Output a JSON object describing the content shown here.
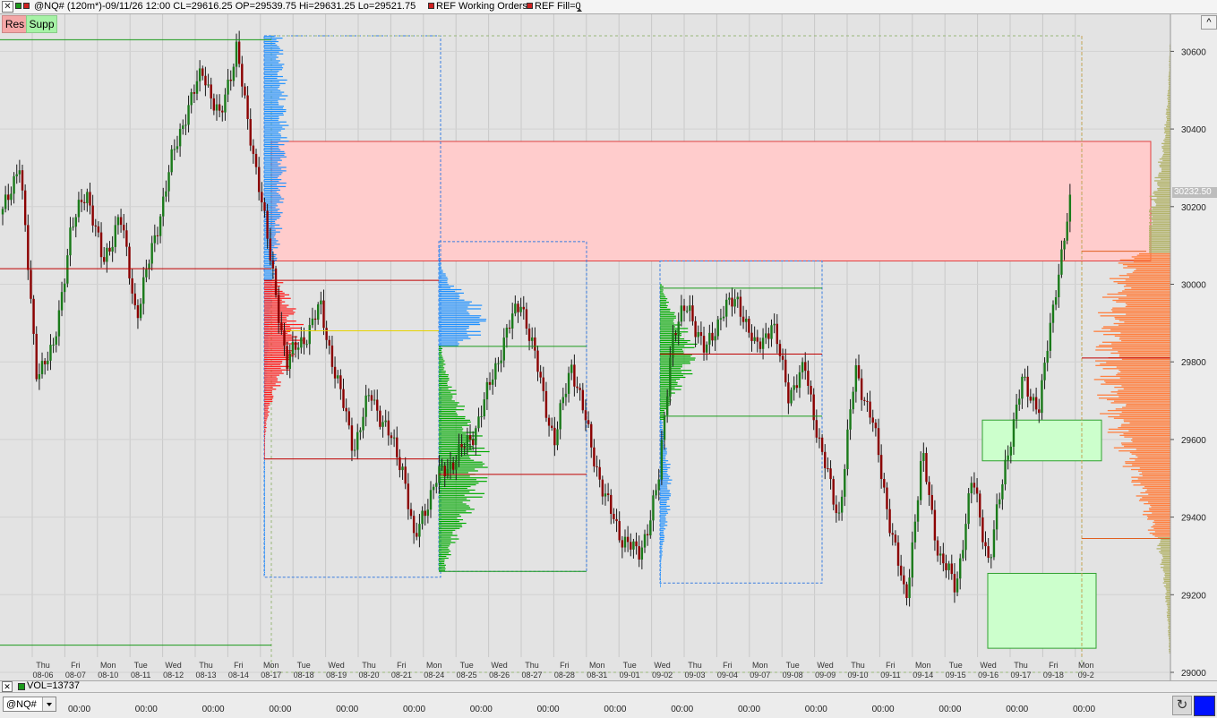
{
  "window": {
    "close_glyph": "✕",
    "title_text": "@NQ# (120m*)-09/11/26 12:00 CL=29616.25 OP=29539.75 Hi=29631.25 Lo=29521.75",
    "legend_working_orders": "REF Working Orders",
    "legend_fill": "REF Fill=0",
    "legend_color": "#e02020"
  },
  "toolbar": {
    "res_label": "Res",
    "supp_label": "Supp",
    "collapse_glyph": "^"
  },
  "colors": {
    "resistance_zone": "#ffcccc",
    "support_zone": "#ccffcc",
    "candle_down": "#8b0000",
    "candle_up": "#1a7a1a",
    "profile_blue": "#1e90ff",
    "profile_red": "#ff1a1a",
    "profile_green": "#00aa00",
    "profile_orange": "#ff8040",
    "profile_olive": "#b3b36b"
  },
  "chart_data": {
    "type": "candlestick",
    "instrument": "@NQ#",
    "interval": "120m",
    "y_axis_range": [
      28990,
      30640
    ],
    "y_ticks": [
      30600,
      30400,
      30200,
      30000,
      29800,
      29600,
      29400,
      29200,
      29000
    ],
    "y_tick_labels": [
      "30600",
      "30400",
      "30200",
      "30000",
      "29800",
      "29600",
      "29400",
      "29200",
      "29000"
    ],
    "last_price_label": "30232.50",
    "x_days": [
      {
        "dow": "Thu",
        "date": "08-06"
      },
      {
        "dow": "Fri",
        "date": "08-07"
      },
      {
        "dow": "Mon",
        "date": "08-10"
      },
      {
        "dow": "Tue",
        "date": "08-11"
      },
      {
        "dow": "Wed",
        "date": "08-12"
      },
      {
        "dow": "Thu",
        "date": "08-13"
      },
      {
        "dow": "Fri",
        "date": "08-14"
      },
      {
        "dow": "Mon",
        "date": "08-17"
      },
      {
        "dow": "Tue",
        "date": "08-18"
      },
      {
        "dow": "Wed",
        "date": "08-19"
      },
      {
        "dow": "Thu",
        "date": "08-20"
      },
      {
        "dow": "Fri",
        "date": "08-21"
      },
      {
        "dow": "Mon",
        "date": "08-24"
      },
      {
        "dow": "Tue",
        "date": "08-25"
      },
      {
        "dow": "Wed",
        "date": "08-26"
      },
      {
        "dow": "Thu",
        "date": "08-27"
      },
      {
        "dow": "Fri",
        "date": "08-28"
      },
      {
        "dow": "Mon",
        "date": "08-31"
      },
      {
        "dow": "Tue",
        "date": "09-01"
      },
      {
        "dow": "Wed",
        "date": "09-02"
      },
      {
        "dow": "Thu",
        "date": "09-03"
      },
      {
        "dow": "Fri",
        "date": "09-04"
      },
      {
        "dow": "Mon",
        "date": "09-07"
      },
      {
        "dow": "Tue",
        "date": "09-08"
      },
      {
        "dow": "Wed",
        "date": "09-09"
      },
      {
        "dow": "Thu",
        "date": "09-10"
      },
      {
        "dow": "Fri",
        "date": "09-11"
      },
      {
        "dow": "Mon",
        "date": "09-14"
      },
      {
        "dow": "Tue",
        "date": "09-15"
      },
      {
        "dow": "Wed",
        "date": "09-16"
      },
      {
        "dow": "Thu",
        "date": "09-17"
      },
      {
        "dow": "Fri",
        "date": "09-18"
      },
      {
        "dow": "Mon",
        "date": "09-2"
      }
    ],
    "price_path": [
      [
        0,
        30180
      ],
      [
        0.5,
        30320
      ],
      [
        1,
        29780
      ],
      [
        1.5,
        29820
      ],
      [
        2,
        30120
      ],
      [
        2.5,
        30250
      ],
      [
        3,
        30050
      ],
      [
        3.5,
        30180
      ],
      [
        4,
        29920
      ],
      [
        4.5,
        30100
      ],
      [
        5,
        30300
      ],
      [
        5.5,
        30450
      ],
      [
        6,
        30550
      ],
      [
        6.5,
        30420
      ],
      [
        7,
        30620
      ],
      [
        7.3,
        30420
      ],
      [
        7.7,
        30250
      ],
      [
        8,
        30060
      ],
      [
        8.5,
        29800
      ],
      [
        9,
        29860
      ],
      [
        9.5,
        29940
      ],
      [
        10,
        29750
      ],
      [
        10.5,
        29580
      ],
      [
        11,
        29720
      ],
      [
        11.5,
        29620
      ],
      [
        12,
        29520
      ],
      [
        12.3,
        29330
      ],
      [
        12.6,
        29420
      ],
      [
        13,
        29500
      ],
      [
        13.5,
        29550
      ],
      [
        14,
        29600
      ],
      [
        14.5,
        29720
      ],
      [
        15,
        29860
      ],
      [
        15.5,
        29960
      ],
      [
        16,
        29780
      ],
      [
        16.5,
        29590
      ],
      [
        17,
        29800
      ],
      [
        17.5,
        29620
      ],
      [
        18,
        29450
      ],
      [
        18.5,
        29350
      ],
      [
        19,
        29300
      ],
      [
        19.3,
        29380
      ],
      [
        19.6,
        29480
      ],
      [
        20,
        29860
      ],
      [
        20.5,
        29950
      ],
      [
        21,
        29820
      ],
      [
        21.5,
        29930
      ],
      [
        22,
        29960
      ],
      [
        22.5,
        29830
      ],
      [
        23,
        29900
      ],
      [
        23.5,
        29720
      ],
      [
        24,
        29780
      ],
      [
        24.5,
        29560
      ],
      [
        25,
        29400
      ],
      [
        25.5,
        29780
      ],
      [
        26,
        29650
      ],
      [
        26.5,
        29400
      ],
      [
        27,
        29180
      ],
      [
        27.5,
        29560
      ],
      [
        28,
        29300
      ],
      [
        28.5,
        29220
      ],
      [
        29,
        29500
      ],
      [
        29.5,
        29280
      ],
      [
        30,
        29550
      ],
      [
        30.5,
        29750
      ],
      [
        31,
        29680
      ],
      [
        31.5,
        30000
      ],
      [
        32,
        30240
      ]
    ],
    "resistance_zone": {
      "price_top": 30368,
      "price_bottom": 30060
    },
    "support_zones": [
      {
        "price_top": 29650,
        "price_bottom": 29545
      },
      {
        "price_top": 29255,
        "price_bottom": 29062
      }
    ],
    "volume_profiles": [
      {
        "color": "profile_blue",
        "price_top": 30640,
        "price_bottom": 29250,
        "poc": 30400
      },
      {
        "color": "profile_red",
        "price_top": 30010,
        "price_bottom": 29550,
        "poc": 29880
      },
      {
        "color": "profile_blue",
        "price_top": 30100,
        "price_bottom": 29840,
        "poc": 29910
      },
      {
        "color": "profile_green",
        "price_top": 29840,
        "price_bottom": 29260,
        "poc": 29530
      },
      {
        "color": "profile_green",
        "price_top": 30000,
        "price_bottom": 29650,
        "poc": 29820
      },
      {
        "color": "profile_blue",
        "price_top": 29650,
        "price_bottom": 29220,
        "poc": 29480
      }
    ],
    "composite_profile": {
      "price_top": 30620,
      "price_bottom": 29050,
      "value_area_top": 30080,
      "value_area_bottom": 29350,
      "poc": 29810
    }
  },
  "volume_panel": {
    "label": "VOL=13737"
  },
  "bottom": {
    "symbol_value": "@NQ#",
    "time_label": "00:00",
    "time_label_count": 16
  }
}
